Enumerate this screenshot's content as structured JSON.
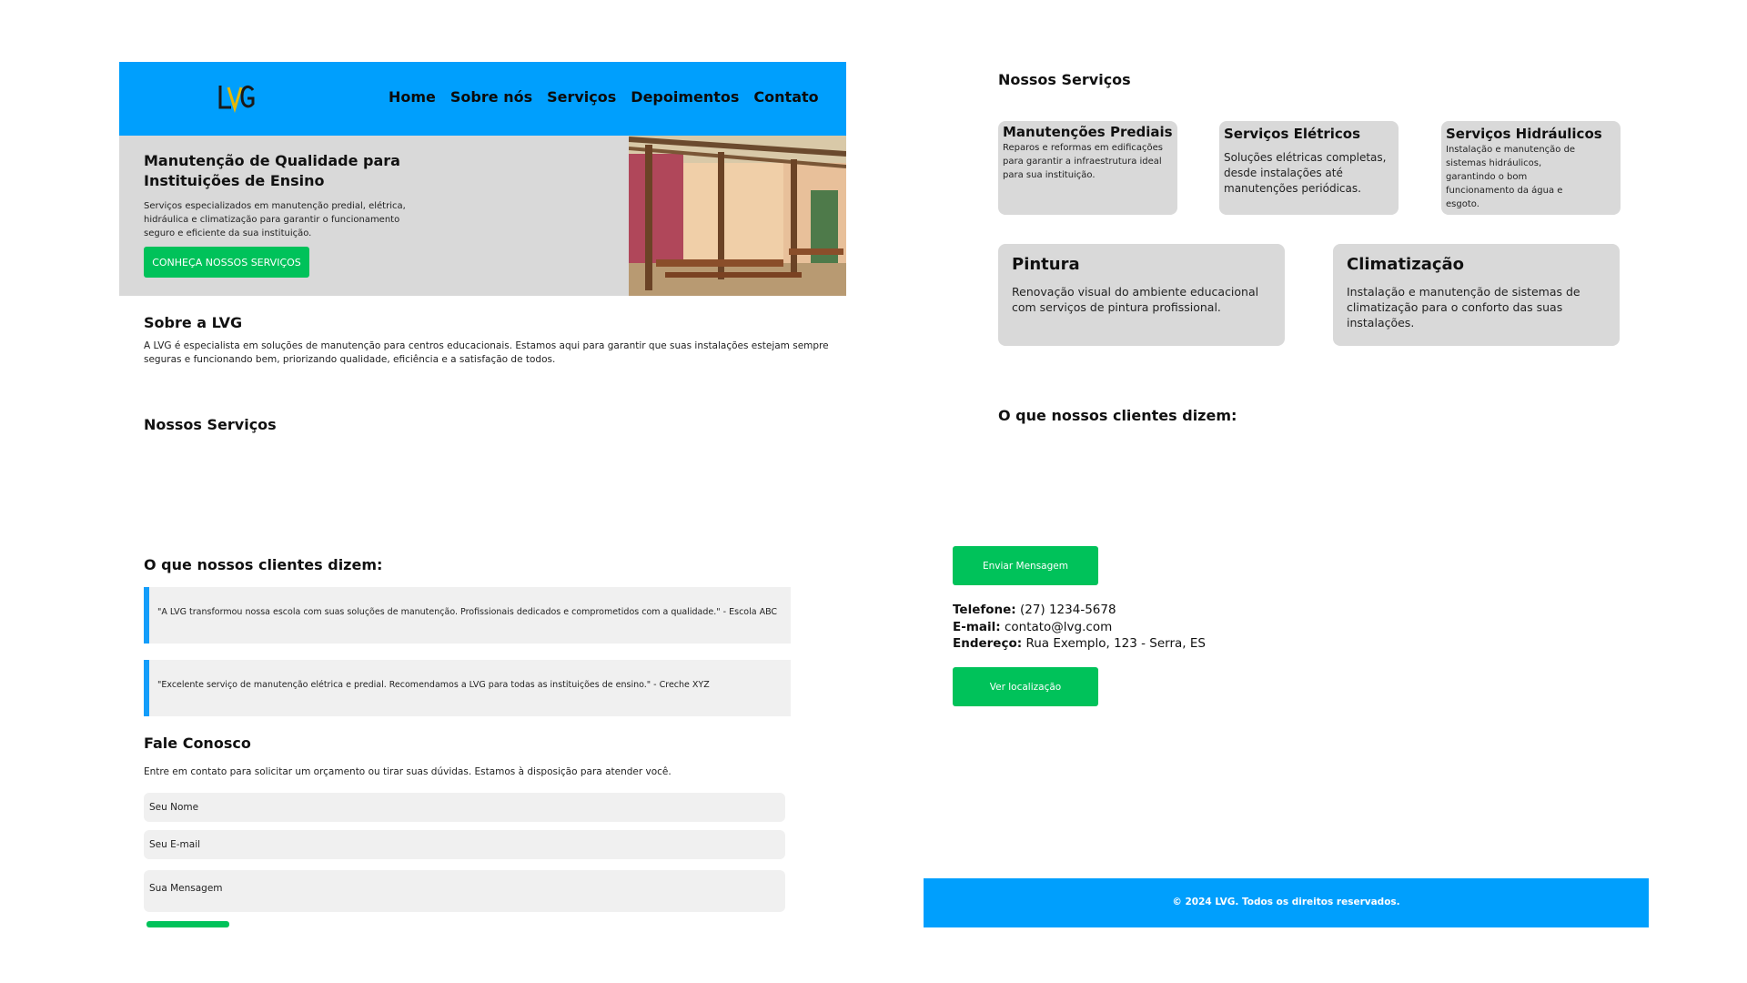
{
  "header": {
    "nav": [
      "Home",
      "Sobre nós",
      "Serviços",
      "Depoimentos",
      "Contato"
    ]
  },
  "hero": {
    "title": "Manutenção de Qualidade para Instituições de Ensino",
    "text": "Serviços especializados em manutenção predial, elétrica, hidráulica e climatização para garantir o funcionamento seguro e eficiente da sua instituição.",
    "button": "CONHEÇA NOSSOS SERVIÇOS"
  },
  "about": {
    "title": "Sobre a LVG",
    "text": "A LVG é especialista em soluções de manutenção para centros educacionais. Estamos aqui para garantir que suas instalações estejam sempre seguras e funcionando bem, priorizando qualidade, eficiência e a satisfação de todos."
  },
  "services_title": "Nossos Serviços",
  "testimonials": {
    "title": "O que nossos clientes dizem:",
    "items": [
      "\"A LVG transformou nossa escola com suas soluções de manutenção. Profissionais dedicados e comprometidos com a qualidade.\" - Escola ABC",
      "\"Excelente serviço de manutenção elétrica e predial. Recomendamos a LVG para todas as instituições de ensino.\" - Creche XYZ"
    ]
  },
  "contact": {
    "title": "Fale Conosco",
    "intro": "Entre em contato para solicitar um orçamento ou tirar suas dúvidas. Estamos à disposição para atender você.",
    "name_placeholder": "Seu Nome",
    "email_placeholder": "Seu E-mail",
    "message_placeholder": "Sua Mensagem"
  },
  "right": {
    "services_title": "Nossos Serviços",
    "cards": [
      {
        "title": "Manutenções Prediais",
        "text": "Reparos e reformas em edificações para garantir a infraestrutura ideal para sua instituição."
      },
      {
        "title": "Serviços Elétricos",
        "text": "Soluções elétricas completas, desde instalações até manutenções periódicas."
      },
      {
        "title": "Serviços Hidráulicos",
        "text": "Instalação e manutenção de sistemas hidráulicos, garantindo o bom funcionamento da água e esgoto."
      },
      {
        "title": "Pintura",
        "text": "Renovação visual do ambiente educacional com serviços de pintura profissional."
      },
      {
        "title": "Climatização",
        "text": "Instalação e manutenção de sistemas de climatização para o conforto das suas instalações."
      }
    ],
    "testimonials_title": "O que nossos clientes dizem:",
    "send_button": "Enviar Mensagem",
    "phone_label": "Telefone:",
    "phone": "(27) 1234-5678",
    "email_label": "E-mail:",
    "email": "contato@lvg.com",
    "address_label": "Endereço:",
    "address": "Rua Exemplo, 123 - Serra, ES",
    "location_button": "Ver localização",
    "footer": "© 2024 LVG. Todos os direitos reservados."
  },
  "colors": {
    "header_blue": "#009ffd",
    "button_green": "#00c25a",
    "card_gray": "#d9d9d9",
    "testimonial_bg": "#f0f0f0",
    "testimonial_border": "#139dfa"
  }
}
